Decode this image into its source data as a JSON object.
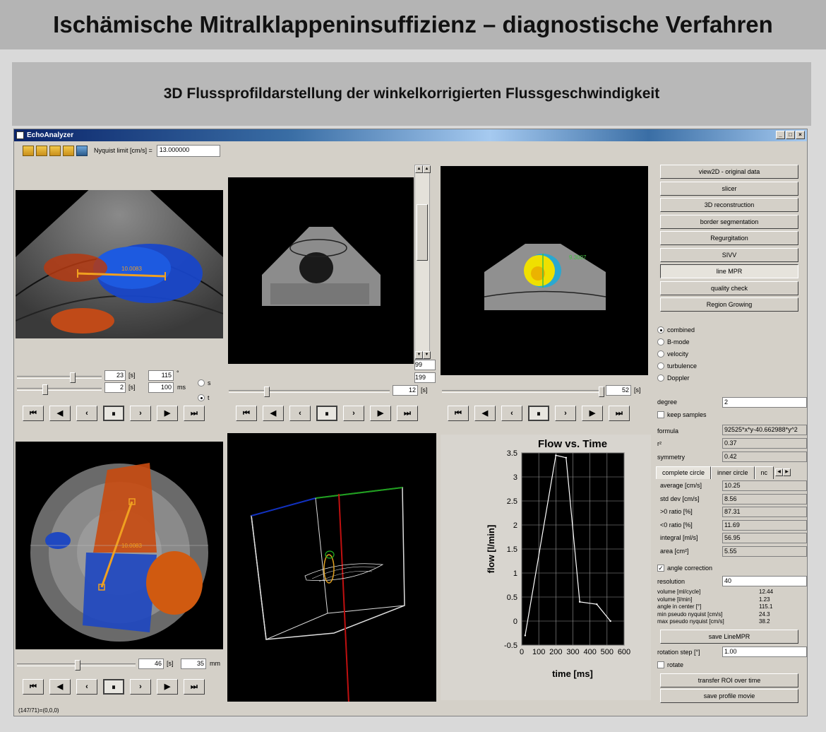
{
  "slide": {
    "title": "Ischämische Mitralklappeninsuffizienz – diagnostische Verfahren",
    "subtitle": "3D Flussprofildarstellung der winkelkorrigierten Flussgeschwindigkeit"
  },
  "window": {
    "title": "EchoAnalyzer",
    "controls": [
      "_",
      "□",
      "×"
    ]
  },
  "toolbar": {
    "icons": [
      "open-icon",
      "open-icon",
      "open-icon",
      "open-icon",
      "save-icon"
    ],
    "nyquist_label": "Nyquist limit [cm/s] =",
    "nyquist_value": "13.000000"
  },
  "panel_top_left": {
    "measure_label": "10.0083",
    "row1": {
      "value": "23",
      "unit1": "[s]",
      "value2": "115",
      "unit2": "°"
    },
    "row2": {
      "value": "2",
      "unit1": "[s]",
      "value2": "100",
      "unit2": "ms"
    },
    "radio_s": "s",
    "radio_t": "t"
  },
  "panel_top_middle": {
    "scroll_value1": "99",
    "scroll_value2": "199",
    "frame_value": "12",
    "frame_unit": "[s]"
  },
  "panel_top_right": {
    "overlay_label": "9.3007",
    "frame_value": "52",
    "frame_unit": "[s]"
  },
  "panel_bottom_left": {
    "measure_label": "10.0083",
    "value": "46",
    "unit1": "[s]",
    "value2": "35",
    "unit2": "mm",
    "status": "(147/71)=(0,0,0)"
  },
  "playback": {
    "buttons": [
      "⏮",
      "◀",
      "‹",
      "⏸",
      "›",
      "▶",
      "⏭"
    ]
  },
  "right_panel": {
    "buttons": [
      "view2D - original data",
      "slicer",
      "3D reconstruction",
      "border segmentation",
      "Regurgitation",
      "SIVV",
      "line MPR",
      "quality check",
      "Region Growing"
    ],
    "pressed_button": "line MPR",
    "modes": [
      "combined",
      "B-mode",
      "velocity",
      "turbulence",
      "Doppler"
    ],
    "selected_mode": "combined",
    "degree_label": "degree",
    "degree_value": "2",
    "keep_samples_label": "keep samples",
    "formula_label": "formula",
    "formula_value": "92525*x*y-40.662988*y^2",
    "r2_label": "r²",
    "r2_value": "0.37",
    "symmetry_label": "symmetry",
    "symmetry_value": "0.42",
    "tabs": [
      "complete circle",
      "inner circle",
      "nc"
    ],
    "stats": [
      {
        "label": "average [cm/s]",
        "value": "10.25"
      },
      {
        "label": "std dev [cm/s]",
        "value": "8.56"
      },
      {
        "label": ">0 ratio [%]",
        "value": "87.31"
      },
      {
        "label": "<0 ratio [%]",
        "value": "11.69"
      },
      {
        "label": "integral [ml/s]",
        "value": "56.95"
      },
      {
        "label": "area [cm²]",
        "value": "5.55"
      }
    ],
    "angle_correction_label": "angle correction",
    "resolution_label": "resolution",
    "resolution_value": "40",
    "results": [
      {
        "label": "volume [ml/cycle]",
        "value": "12.44"
      },
      {
        "label": "volume [l/min]",
        "value": "1.23"
      },
      {
        "label": "angle in center [°]",
        "value": "115.1"
      },
      {
        "label": "min pseudo nyquist [cm/s]",
        "value": "24.3"
      },
      {
        "label": "max pseudo nyquist [cm/s]",
        "value": "38.2"
      }
    ],
    "save_linempr": "save LineMPR",
    "rotation_step_label": "rotation step [°]",
    "rotation_step_value": "1.00",
    "rotate_label": "rotate",
    "transfer_roi": "transfer ROI over time",
    "save_profile_movie": "save profile movie"
  },
  "chart_data": {
    "type": "line",
    "title": "Flow vs. Time",
    "xlabel": "time [ms]",
    "ylabel": "flow [l/min]",
    "xlim": [
      0,
      600
    ],
    "ylim": [
      -0.5,
      3.5
    ],
    "xticks": [
      "0",
      "100",
      "200",
      "300",
      "400",
      "500",
      "600"
    ],
    "yticks": [
      "-0.5",
      "0",
      "0.5",
      "1",
      "1.5",
      "2",
      "2.5",
      "3",
      "3.5"
    ],
    "grid": true,
    "x": [
      20,
      200,
      260,
      340,
      440,
      520
    ],
    "y": [
      -0.3,
      3.45,
      3.4,
      0.4,
      0.35,
      0.0
    ],
    "line_color": "#ffffff"
  }
}
